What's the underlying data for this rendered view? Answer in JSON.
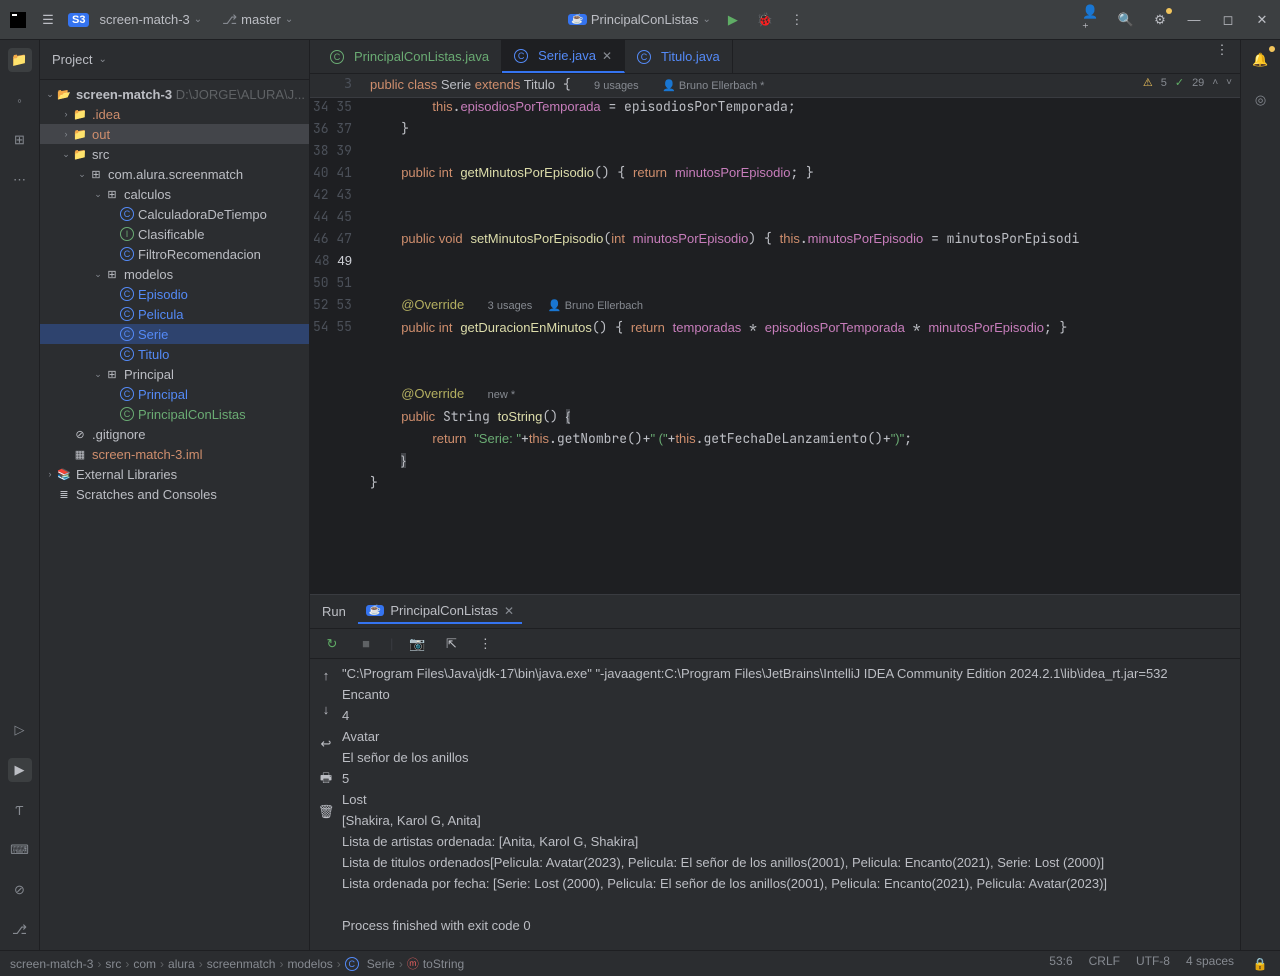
{
  "titlebar": {
    "project_badge": "S3",
    "project_name": "screen-match-3",
    "branch": "master",
    "run_config": "PrincipalConListas"
  },
  "panel_title": "Project",
  "tree": {
    "root": "screen-match-3",
    "root_path": "D:\\JORGE\\ALURA\\J...",
    "idea": ".idea",
    "out": "out",
    "src": "src",
    "pkg": "com.alura.screenmatch",
    "calculos": "calculos",
    "calc1": "CalculadoraDeTiempo",
    "calc2": "Clasificable",
    "calc3": "FiltroRecomendacion",
    "modelos": "modelos",
    "m1": "Episodio",
    "m2": "Pelicula",
    "m3": "Serie",
    "m4": "Titulo",
    "principal": "Principal",
    "p1": "Principal",
    "p2": "PrincipalConListas",
    "gitignore": ".gitignore",
    "iml": "screen-match-3.iml",
    "ext": "External Libraries",
    "scratch": "Scratches and Consoles"
  },
  "tabs": {
    "t1": "PrincipalConListas.java",
    "t2": "Serie.java",
    "t3": "Titulo.java"
  },
  "sticky": {
    "line": "3",
    "usages": "9 usages",
    "author": "Bruno Ellerbach *"
  },
  "warnings": {
    "w": "5",
    "i": "29"
  },
  "code_hints": {
    "override1_usages": "3 usages",
    "override1_author": "Bruno Ellerbach",
    "override2_new": "new *"
  },
  "run": {
    "title": "Run",
    "tab": "PrincipalConListas"
  },
  "console_lines": [
    "\"C:\\Program Files\\Java\\jdk-17\\bin\\java.exe\" \"-javaagent:C:\\Program Files\\JetBrains\\IntelliJ IDEA Community Edition 2024.2.1\\lib\\idea_rt.jar=532",
    "Encanto",
    "4",
    "Avatar",
    "El señor de los anillos",
    "5",
    "Lost",
    "[Shakira, Karol G, Anita]",
    "Lista de artistas ordenada: [Anita, Karol G, Shakira]",
    "Lista de titulos ordenados[Pelicula: Avatar(2023), Pelicula: El señor de los anillos(2001), Pelicula: Encanto(2021), Serie: Lost (2000)]",
    "Lista ordenada por fecha: [Serie: Lost (2000), Pelicula: El señor de los anillos(2001), Pelicula: Encanto(2021), Pelicula: Avatar(2023)]",
    "",
    "Process finished with exit code 0"
  ],
  "breadcrumb": [
    "screen-match-3",
    "src",
    "com",
    "alura",
    "screenmatch",
    "modelos",
    "Serie",
    "toString"
  ],
  "status": {
    "pos": "53:6",
    "eol": "CRLF",
    "enc": "UTF-8",
    "indent": "4 spaces"
  }
}
